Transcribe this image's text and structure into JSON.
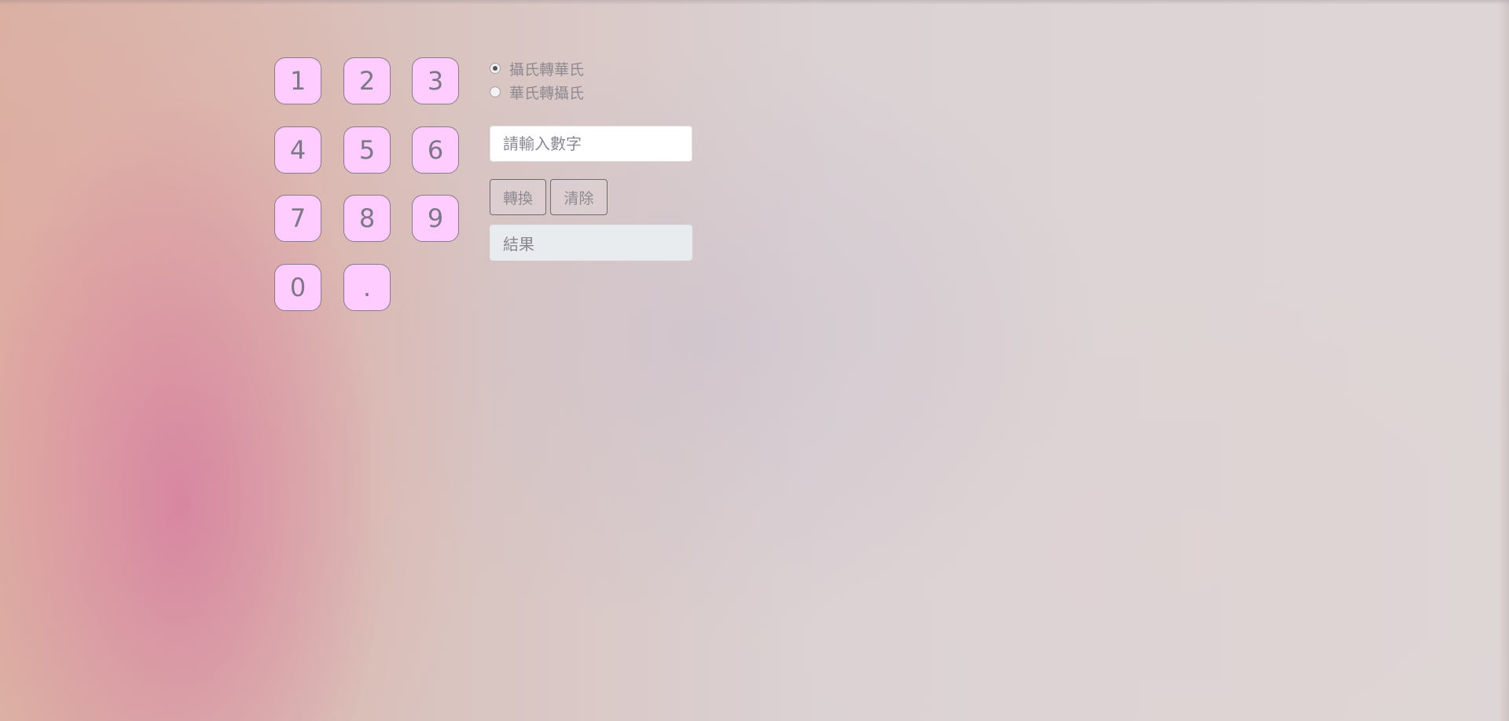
{
  "keypad": {
    "keys": [
      "1",
      "2",
      "3",
      "4",
      "5",
      "6",
      "7",
      "8",
      "9",
      "0",
      "."
    ]
  },
  "conversion": {
    "options": [
      {
        "label": "攝氏轉華氏",
        "checked": true
      },
      {
        "label": "華氏轉攝氏",
        "checked": false
      }
    ],
    "input_placeholder": "請輸入數字",
    "convert_label": "轉換",
    "clear_label": "清除",
    "result_label": "結果"
  },
  "colors": {
    "key_background": "#ffccff",
    "key_border": "#8a7a8f",
    "result_background": "#e9ecef"
  }
}
